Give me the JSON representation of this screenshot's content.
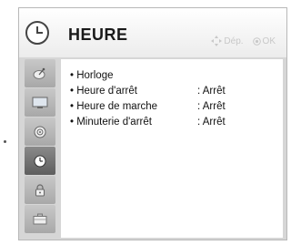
{
  "menu": {
    "title": "HEURE",
    "hints": {
      "move_label": "Dép.",
      "ok_label": "OK"
    }
  },
  "sidebar": {
    "items": [
      {
        "icon": "satellite-dish-icon",
        "active": false
      },
      {
        "icon": "tv-screen-icon",
        "active": false
      },
      {
        "icon": "speaker-icon",
        "active": false
      },
      {
        "icon": "clock-icon",
        "active": true
      },
      {
        "icon": "lock-icon",
        "active": false
      },
      {
        "icon": "briefcase-icon",
        "active": false
      }
    ]
  },
  "time_menu": {
    "rows": [
      {
        "label": "• Horloge",
        "value": ""
      },
      {
        "label": "• Heure d'arrêt",
        "value": ": Arrêt"
      },
      {
        "label": "• Heure de marche",
        "value": ": Arrêt"
      },
      {
        "label": "• Minuterie d'arrêt",
        "value": ": Arrêt"
      }
    ]
  }
}
